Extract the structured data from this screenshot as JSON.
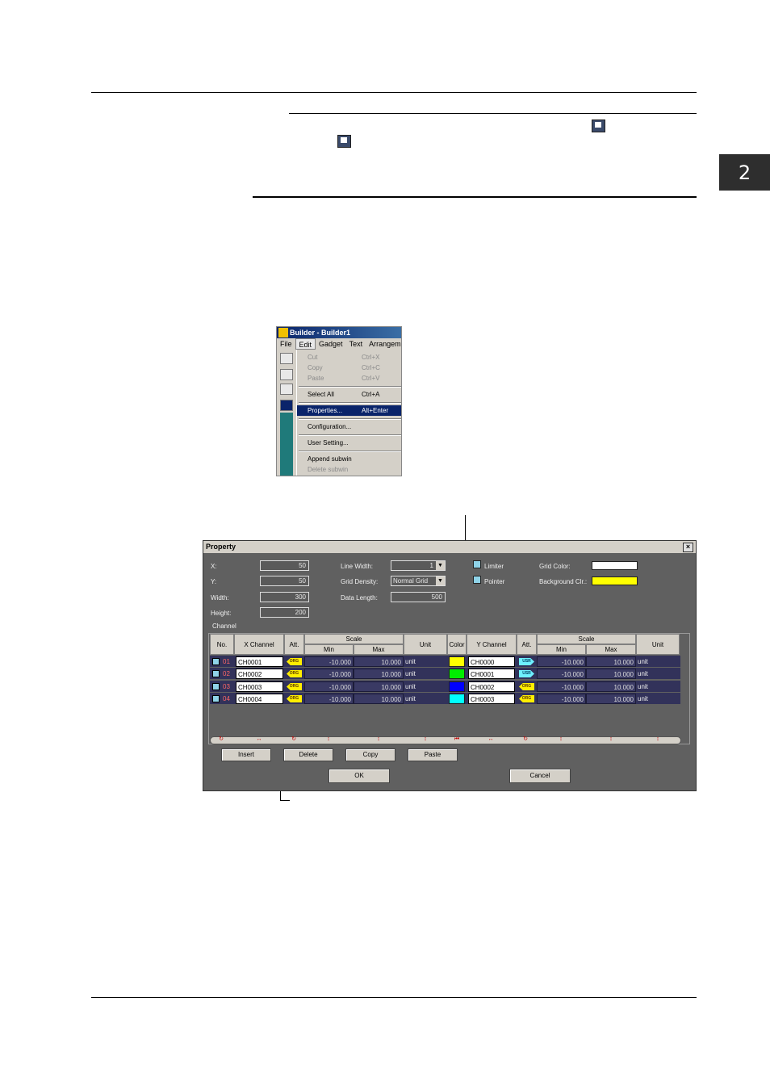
{
  "page": {
    "chapter": "2"
  },
  "menu_screenshot": {
    "title": "Builder - Builder1",
    "menubar": [
      "File",
      "Edit",
      "Gadget",
      "Text",
      "Arrangemen"
    ],
    "items": [
      {
        "label": "Cut",
        "key": "Ctrl+X",
        "disabled": true
      },
      {
        "label": "Copy",
        "key": "Ctrl+C",
        "disabled": true
      },
      {
        "label": "Paste",
        "key": "Ctrl+V",
        "disabled": true
      },
      {
        "label": "Select All",
        "key": "Ctrl+A"
      },
      {
        "label": "Properties...",
        "key": "Alt+Enter",
        "selected": true
      },
      {
        "label": "Configuration..."
      },
      {
        "label": "User Setting..."
      },
      {
        "label": "Append subwin"
      },
      {
        "label": "Delete subwin",
        "disabled": true
      }
    ]
  },
  "dialog": {
    "title": "Property",
    "close": "×",
    "fields": {
      "x": {
        "label": "X:",
        "value": "50"
      },
      "y": {
        "label": "Y:",
        "value": "50"
      },
      "width": {
        "label": "Width:",
        "value": "300"
      },
      "height": {
        "label": "Height:",
        "value": "200"
      },
      "line_width": {
        "label": "Line Width:",
        "value": "1"
      },
      "grid_density": {
        "label": "Grid Density:",
        "value": "Normal Grid"
      },
      "data_length": {
        "label": "Data Length:",
        "value": "500"
      }
    },
    "limiter": "Limiter",
    "pointer": "Pointer",
    "grid_color": {
      "label": "Grid Color:",
      "color": "#ffffff"
    },
    "background_color": {
      "label": "Background Clr.:",
      "color": "#ffff00"
    },
    "channel_group": "Channel",
    "headers": {
      "no": "No.",
      "x_channel": "X Channel",
      "att": "Att.",
      "scale": "Scale",
      "min": "Min",
      "max": "Max",
      "unit": "Unit",
      "color": "Color",
      "y_channel": "Y Channel"
    },
    "rows": [
      {
        "no": "01",
        "x_ch": "CH0001",
        "x_att": "ORG",
        "x_min": "-10.000",
        "x_max": "10.000",
        "x_unit": "unit",
        "color": "#ffff00",
        "y_ch": "CH0000",
        "y_att": "USR",
        "y_min": "-10.000",
        "y_max": "10.000",
        "y_unit": "unit"
      },
      {
        "no": "02",
        "x_ch": "CH0002",
        "x_att": "ORG",
        "x_min": "-10.000",
        "x_max": "10.000",
        "x_unit": "unit",
        "color": "#00ee00",
        "y_ch": "CH0001",
        "y_att": "USR",
        "y_min": "-10.000",
        "y_max": "10.000",
        "y_unit": "unit"
      },
      {
        "no": "03",
        "x_ch": "CH0003",
        "x_att": "ORG",
        "x_min": "-10.000",
        "x_max": "10.000",
        "x_unit": "unit",
        "color": "#0000ff",
        "y_ch": "CH0002",
        "y_att": "ORG",
        "y_min": "-10.000",
        "y_max": "10.000",
        "y_unit": "unit"
      },
      {
        "no": "04",
        "x_ch": "CH0004",
        "x_att": "ORG",
        "x_min": "-10.000",
        "x_max": "10.000",
        "x_unit": "unit",
        "color": "#00ffff",
        "y_ch": "CH0003",
        "y_att": "ORG",
        "y_min": "-10.000",
        "y_max": "10.000",
        "y_unit": "unit"
      }
    ],
    "sort_icons": [
      "↻",
      "↔",
      "↻",
      "↕",
      "↕",
      "↕",
      "⏮",
      "↔",
      "↻",
      "↕",
      "↕",
      "↕"
    ],
    "buttons": {
      "insert": "Insert",
      "delete": "Delete",
      "copy": "Copy",
      "paste": "Paste",
      "ok": "OK",
      "cancel": "Cancel"
    }
  }
}
